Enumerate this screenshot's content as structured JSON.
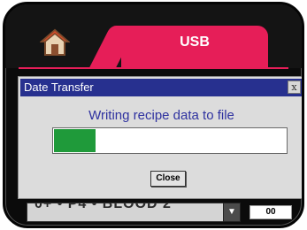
{
  "tabs": {
    "home_icon": "home-icon",
    "usb_label": "USB"
  },
  "dialog": {
    "title": "Date Transfer",
    "close_x": "x",
    "message": "Writing recipe data to file",
    "progress": 0.18,
    "close_button": "Close"
  },
  "background_row": {
    "field_text": "0+  • P4 • BLOOD 2",
    "dropdown_icon": "chevron-down-icon",
    "value": "00"
  },
  "colors": {
    "tab_accent": "#e61e58",
    "titlebar": "#27308f",
    "progress_fill": "#1f9a3a",
    "message_text": "#2f32a0"
  }
}
